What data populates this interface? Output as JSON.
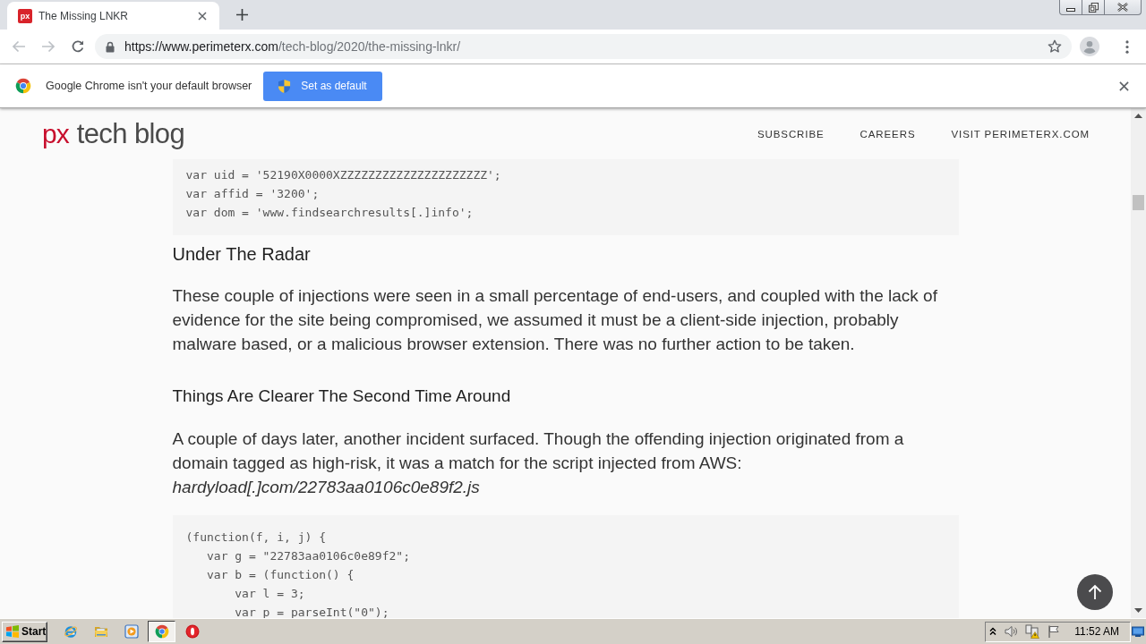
{
  "browser": {
    "tabs": [
      {
        "favicon_text": "px",
        "title": "The Missing LNKR",
        "selected": true
      }
    ],
    "address_bar": {
      "url_host": "https://www.perimeterx.com",
      "url_path": "/tech-blog/2020/the-missing-lnkr/"
    },
    "infobar": {
      "message": "Google Chrome isn't your default browser",
      "button": "Set as default"
    }
  },
  "page": {
    "header": {
      "logo_mark": "px",
      "logo_text": "tech blog",
      "nav": [
        {
          "label": "SUBSCRIBE"
        },
        {
          "label": "CAREERS"
        },
        {
          "label": "VISIT PERIMETERX.COM"
        }
      ]
    },
    "content": [
      {
        "kind": "code",
        "lines": [
          "var uid = '52190X0000XZZZZZZZZZZZZZZZZZZZZZ';",
          "var affid = '3200';",
          "var dom = 'www.findsearchresults[.]info';"
        ]
      },
      {
        "kind": "heading",
        "text": "Under The Radar"
      },
      {
        "kind": "paragraph",
        "text": "These couple of injections were seen in a small percentage of end-users, and coupled with the lack of evidence for the site being compromised, we assumed it must be a client-side injection, probably malware based, or a malicious browser extension. There was no further action to be taken."
      },
      {
        "kind": "subheading",
        "text": "Things Are Clearer The Second Time Around"
      },
      {
        "kind": "paragraph",
        "text": "A couple of days later, another incident surfaced. Though the offending injection originated from a domain tagged as high-risk, it was a match for the script injected from AWS: *hardyload[.]com/22783aa0106c0e89f2.js*"
      },
      {
        "kind": "code",
        "lines": [
          "(function(f, i, j) {",
          "   var g = \"22783aa0106c0e89f2\";",
          "   var b = (function() {",
          "       var l = 3;",
          "       var p = parseInt(\"0\");"
        ]
      }
    ]
  },
  "taskbar": {
    "start_label": "Start",
    "apps": [
      {
        "selected": false
      },
      {
        "selected": false
      },
      {
        "selected": false
      },
      {
        "selected": true
      },
      {
        "selected": false
      }
    ],
    "clock": "11:52 AM"
  }
}
